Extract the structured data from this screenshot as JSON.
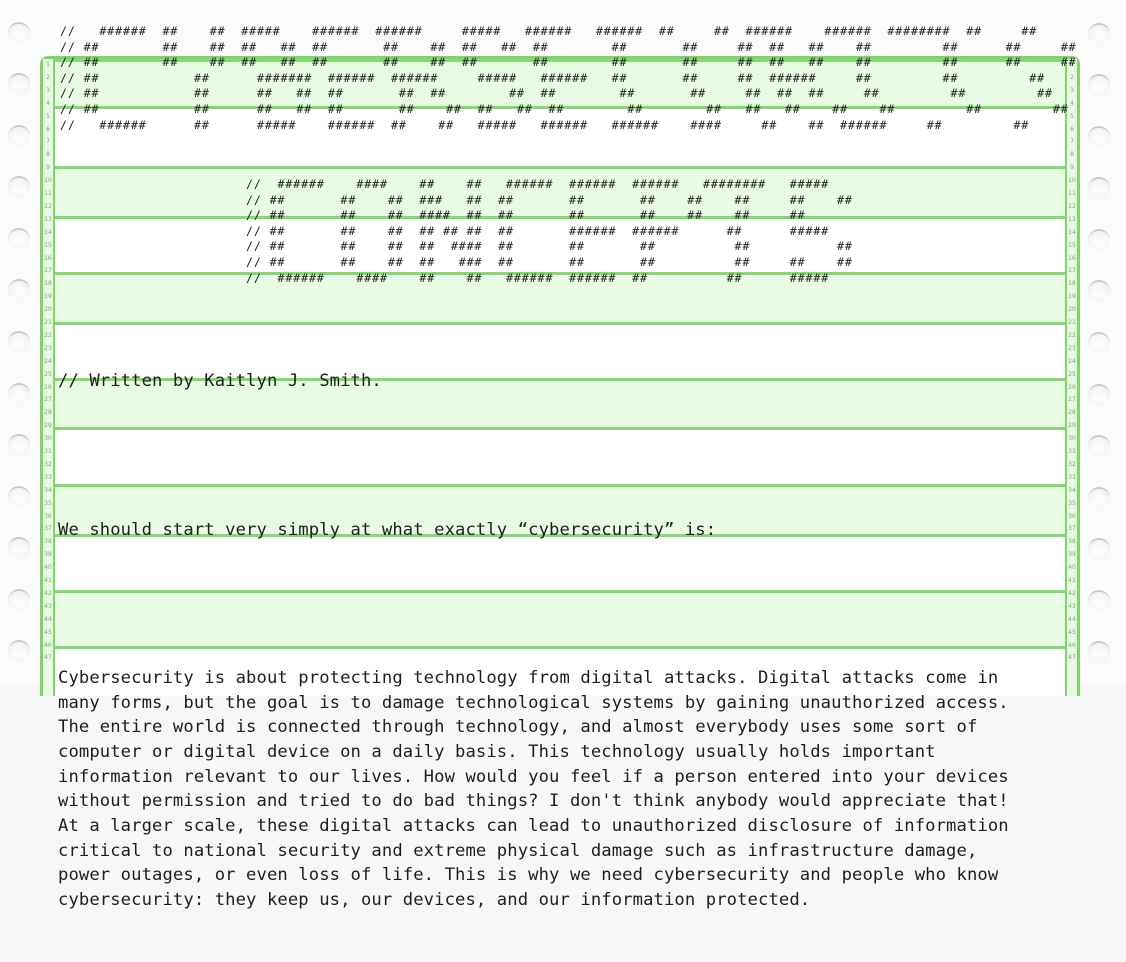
{
  "document": {
    "title_ascii_lines": [
      "//   ######  ##    ##  #####    ######  ######     #####   ######   ######  ##     ##  ######    ######  ########  ##     ##",
      "// ##        ##    ##  ##   ##  ##       ##    ##  ##   ##  ##        ##       ##     ##  ##   ##    ##         ##      ##     ##",
      "// ##        ##    ##  ##   ##  ##       ##    ##  ##       ##        ##       ##     ##  ##   ##    ##         ##      ##     ##",
      "// ##            ##      #######  ######  ######     #####   ######   ##       ##     ##  ######     ##         ##         ##",
      "// ##            ##      ##   ##  ##       ##  ##        ##  ##        ##       ##     ##  ##  ##     ##         ##         ##",
      "// ##            ##      ##   ##  ##       ##    ##  ##   ##  ##        ##        ##   ##   ##    ##    ##         ##         ##",
      "//   ######      ##      #####    ######  ##    ##   #####   ######   ######    ####     ##    ##  ######     ##         ##"
    ],
    "subtitle_ascii_lines": [
      "//  ######    ####    ##    ##   ######  ######  ######   ########   #####",
      "// ##       ##    ##  ###   ##  ##       ##       ##    ##    ##     ##    ##",
      "// ##       ##    ##  ####  ##  ##       ##       ##    ##    ##     ##",
      "// ##       ##    ##  ## ## ##  ##       ######  ######      ##      #####",
      "// ##       ##    ##  ##  ####  ##       ##       ##          ##           ##",
      "// ##       ##    ##  ##   ###  ##       ##       ##          ##     ##    ##",
      "//  ######    ####    ##    ##   ######  ######  ##          ##      #####"
    ],
    "byline": "// Written by Kaitlyn J. Smith.",
    "intro": "We should start very simply at what exactly “cybersecurity” is:",
    "paragraph_lines": [
      "Cybersecurity is about protecting technology from digital attacks. Digital attacks come in",
      "many forms, but the goal is to damage technological systems by gaining unauthorized access.",
      "The entire world is connected through technology, and almost everybody uses some sort of",
      "computer or digital device on a daily basis. This technology usually holds important",
      "information relevant to our lives. How would you feel if a person entered into your devices",
      "without permission and tried to do bad things? I don't think anybody would appreciate that!",
      "At a larger scale, these digital attacks can lead to unauthorized disclosure of information",
      "critical to national security and extreme physical damage such as infrastructure damage,",
      "power outages, or even loss of life. This is why we need cybersecurity and people who know",
      "cybersecurity: they keep us, our devices, and our information protected."
    ]
  },
  "line_numbers": [
    "1",
    "2",
    "3",
    "4",
    "5",
    "6",
    "7",
    "8",
    "9",
    "10",
    "11",
    "12",
    "13",
    "14",
    "15",
    "16",
    "17",
    "18",
    "19",
    "20",
    "21",
    "22",
    "23",
    "24",
    "25",
    "26",
    "27",
    "28",
    "29",
    "30",
    "31",
    "32",
    "33",
    "34",
    "35",
    "36",
    "37",
    "38",
    "39",
    "40",
    "41",
    "42",
    "43",
    "44",
    "45",
    "46",
    "47"
  ],
  "theme": {
    "band_color": "#e8fbe3",
    "rule_color": "#7ed56a",
    "paper_color": "#ffffff"
  }
}
